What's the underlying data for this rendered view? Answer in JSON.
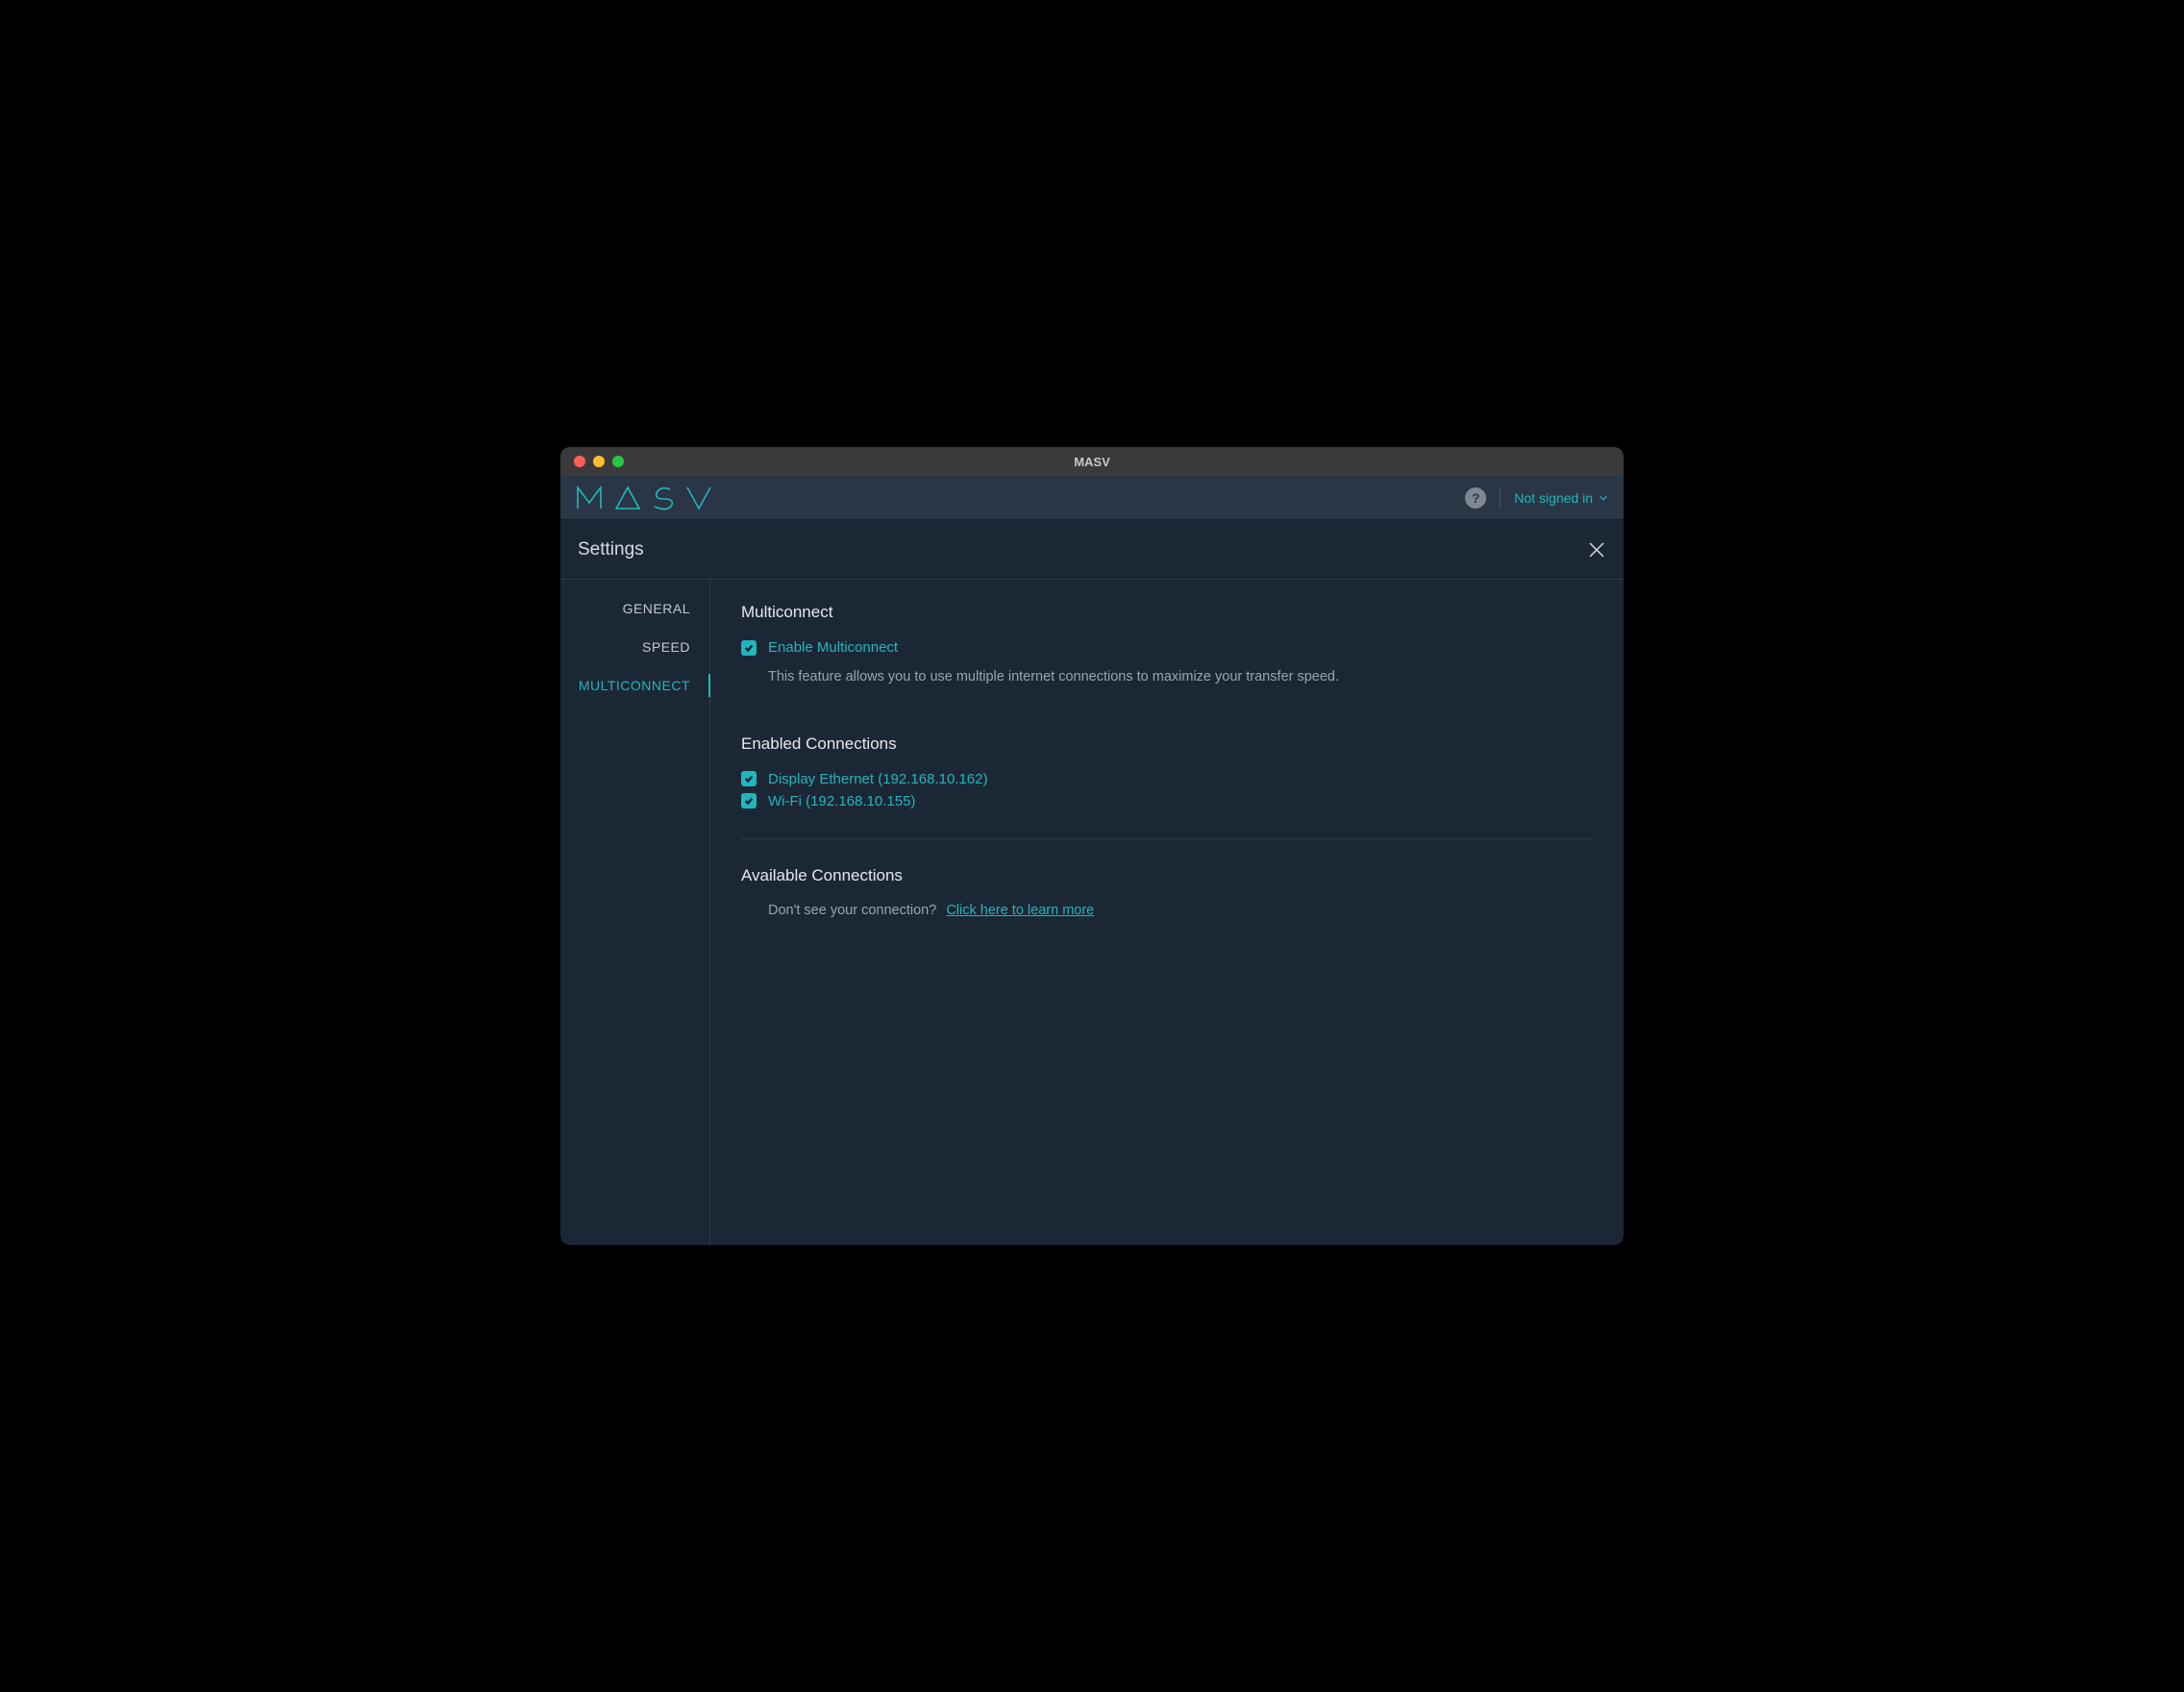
{
  "titlebar": {
    "title": "MASV"
  },
  "topbar": {
    "logo_text": "M A S V",
    "signin_label": "Not signed in"
  },
  "subheader": {
    "title": "Settings"
  },
  "sidebar": {
    "items": [
      {
        "label": "GENERAL"
      },
      {
        "label": "SPEED"
      },
      {
        "label": "MULTICONNECT"
      }
    ]
  },
  "multiconnect": {
    "heading": "Multiconnect",
    "enable_label": "Enable Multiconnect",
    "description": "This feature allows you to use multiple internet connections to maximize your transfer speed."
  },
  "enabled_connections": {
    "heading": "Enabled Connections",
    "items": [
      {
        "label": "Display Ethernet (192.168.10.162)"
      },
      {
        "label": "Wi-Fi (192.168.10.155)"
      }
    ]
  },
  "available_connections": {
    "heading": "Available Connections",
    "prompt": "Don't see your connection?",
    "link_text": "Click here to learn more"
  }
}
